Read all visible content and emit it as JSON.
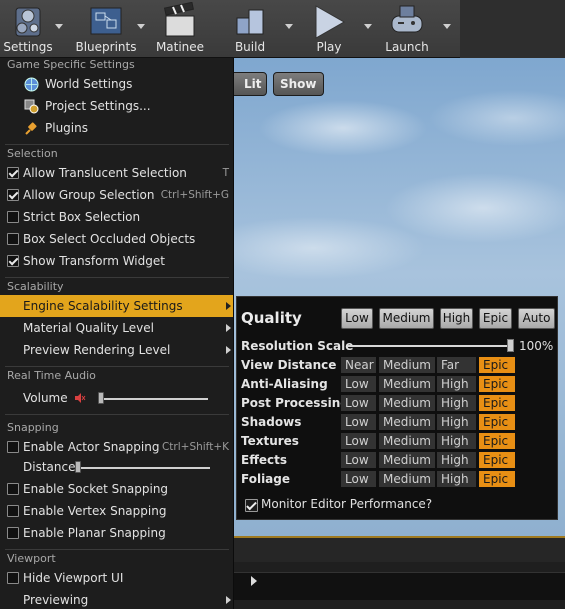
{
  "toolbar": {
    "buttons": [
      {
        "label": "Settings",
        "icon": "gear-icon"
      },
      {
        "label": "Blueprints",
        "icon": "blueprint-icon"
      },
      {
        "label": "Matinee",
        "icon": "clapperboard-icon"
      },
      {
        "label": "Build",
        "icon": "build-cubes-icon"
      },
      {
        "label": "Play",
        "icon": "play-icon"
      },
      {
        "label": "Launch",
        "icon": "gamepad-icon"
      }
    ]
  },
  "viewport": {
    "lit_label": "Lit",
    "show_label": "Show"
  },
  "menu": {
    "sections": {
      "game": "Game Specific Settings",
      "selection": "Selection",
      "scalability": "Scalability",
      "audio": "Real Time Audio",
      "snapping": "Snapping",
      "viewport": "Viewport"
    },
    "game_items": [
      {
        "label": "World Settings",
        "icon": "globe-icon"
      },
      {
        "label": "Project Settings...",
        "icon": "project-gear-icon"
      },
      {
        "label": "Plugins",
        "icon": "plug-icon"
      }
    ],
    "selection_items": [
      {
        "label": "Allow Translucent Selection",
        "shortcut": "T",
        "checked": true
      },
      {
        "label": "Allow Group Selection",
        "shortcut": "Ctrl+Shift+G",
        "checked": true
      },
      {
        "label": "Strict Box Selection",
        "shortcut": "",
        "checked": false
      },
      {
        "label": "Box Select Occluded Objects",
        "shortcut": "",
        "checked": false
      },
      {
        "label": "Show Transform Widget",
        "shortcut": "",
        "checked": true
      }
    ],
    "scalability_items": [
      {
        "label": "Engine Scalability Settings",
        "highlighted": true
      },
      {
        "label": "Material Quality Level",
        "highlighted": false
      },
      {
        "label": "Preview Rendering Level",
        "highlighted": false
      }
    ],
    "volume_label": "Volume",
    "volume_level": 0.0,
    "snapping": {
      "actor_label": "Enable Actor Snapping",
      "actor_shortcut": "Ctrl+Shift+K",
      "actor_checked": false,
      "distance_label": "Distance",
      "distance_level": 0.0,
      "socket_label": "Enable Socket Snapping",
      "vertex_label": "Enable Vertex Snapping",
      "planar_label": "Enable Planar Snapping"
    },
    "viewport_items": {
      "hide_ui_label": "Hide Viewport UI",
      "previewing_label": "Previewing"
    }
  },
  "quality": {
    "title": "Quality",
    "presets": [
      "Low",
      "Medium",
      "High",
      "Epic",
      "Auto"
    ],
    "resolution_scale_label": "Resolution Scale",
    "resolution_scale_value": "100%",
    "resolution_scale_level": 1.0,
    "rows": [
      {
        "label": "View Distance",
        "options": [
          "Near",
          "Medium",
          "Far",
          "Epic"
        ],
        "selected": 3
      },
      {
        "label": "Anti-Aliasing",
        "options": [
          "Low",
          "Medium",
          "High",
          "Epic"
        ],
        "selected": 3
      },
      {
        "label": "Post Processing",
        "options": [
          "Low",
          "Medium",
          "High",
          "Epic"
        ],
        "selected": 3
      },
      {
        "label": "Shadows",
        "options": [
          "Low",
          "Medium",
          "High",
          "Epic"
        ],
        "selected": 3
      },
      {
        "label": "Textures",
        "options": [
          "Low",
          "Medium",
          "High",
          "Epic"
        ],
        "selected": 3
      },
      {
        "label": "Effects",
        "options": [
          "Low",
          "Medium",
          "High",
          "Epic"
        ],
        "selected": 3
      },
      {
        "label": "Foliage",
        "options": [
          "Low",
          "Medium",
          "High",
          "Epic"
        ],
        "selected": 3
      }
    ],
    "monitor_label": "Monitor Editor Performance?",
    "monitor_checked": true
  },
  "colors": {
    "highlight": "#e3a51c",
    "epic_selected": "#e88f14",
    "menu_bg": "#1d1d1d"
  }
}
